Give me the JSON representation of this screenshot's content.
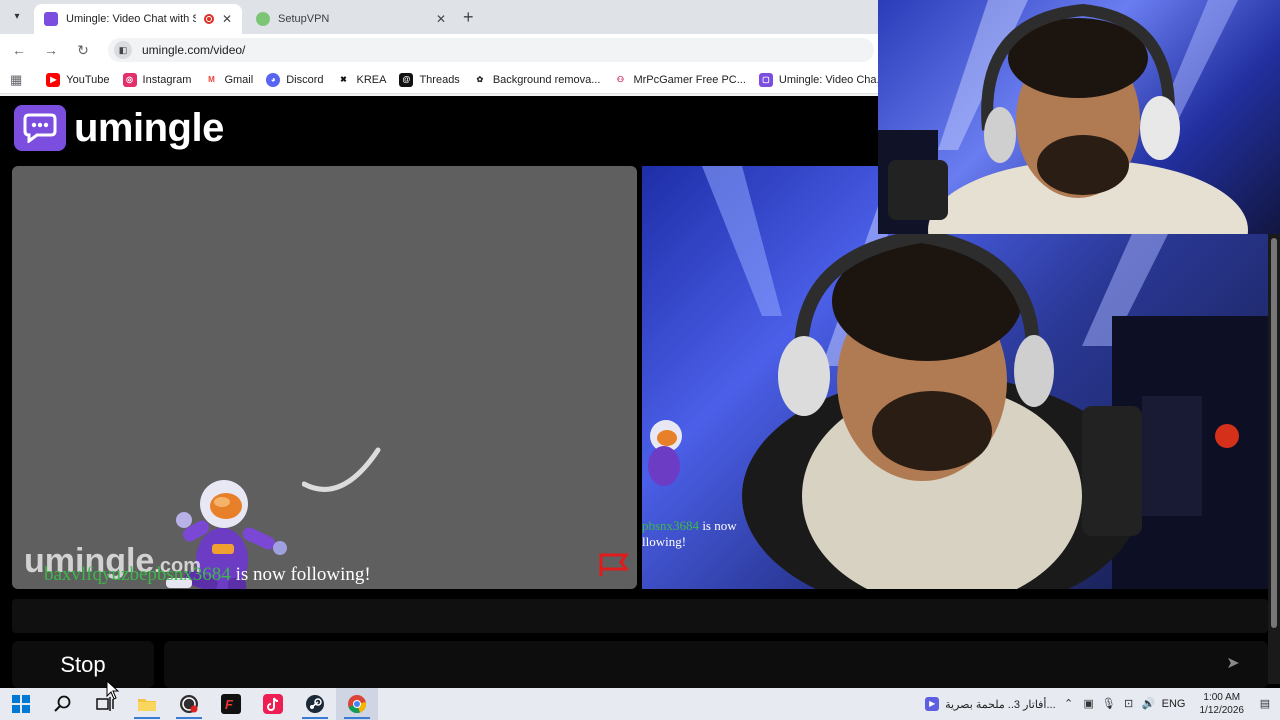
{
  "browser": {
    "tabs": [
      {
        "title": "Umingle: Video Chat with St",
        "active": true,
        "recording": true
      },
      {
        "title": "SetupVPN",
        "active": false
      }
    ],
    "url": "umingle.com/video/",
    "bookmarks": [
      {
        "label": "YouTube",
        "icon": "youtube-icon",
        "color": "#ff0000"
      },
      {
        "label": "Instagram",
        "icon": "instagram-icon",
        "color": "#e1306c"
      },
      {
        "label": "Gmail",
        "icon": "gmail-icon",
        "color": "#ea4335"
      },
      {
        "label": "Discord",
        "icon": "discord-icon",
        "color": "#5865f2"
      },
      {
        "label": "KREA",
        "icon": "krea-icon",
        "color": "#111111"
      },
      {
        "label": "Threads",
        "icon": "threads-icon",
        "color": "#111111"
      },
      {
        "label": "Background remova...",
        "icon": "background-remover-icon",
        "color": "#222222"
      },
      {
        "label": "MrPcGamer Free PC...",
        "icon": "mrpcgamer-icon",
        "color": "#c2185b"
      },
      {
        "label": "Umingle: Video Cha...",
        "icon": "umingle-icon",
        "color": "#7b4ee0"
      }
    ]
  },
  "site": {
    "logo_text": "umingle",
    "brand_color": "#7b4ee0",
    "watermark": {
      "main": "umingle",
      "suffix": ".com"
    },
    "follow_notice": {
      "username": "baxvlfqyuzbepbsnx3684",
      "text": "is now following!"
    },
    "self_overlay": {
      "username": "pbsnx3684",
      "line1_suffix": "is now",
      "line2": "llowing!"
    },
    "stop_label": "Stop"
  },
  "taskbar": {
    "apps": [
      "windows-start-icon",
      "search-icon",
      "task-view-icon",
      "file-explorer-icon",
      "obs-icon",
      "tf-app-icon",
      "tiktok-icon",
      "steam-icon",
      "chrome-icon"
    ],
    "notification_text": "أفاتار 3.. ملحمة بصرية...",
    "language": "ENG",
    "time": "1:00 AM",
    "date": "1/12/2026"
  }
}
